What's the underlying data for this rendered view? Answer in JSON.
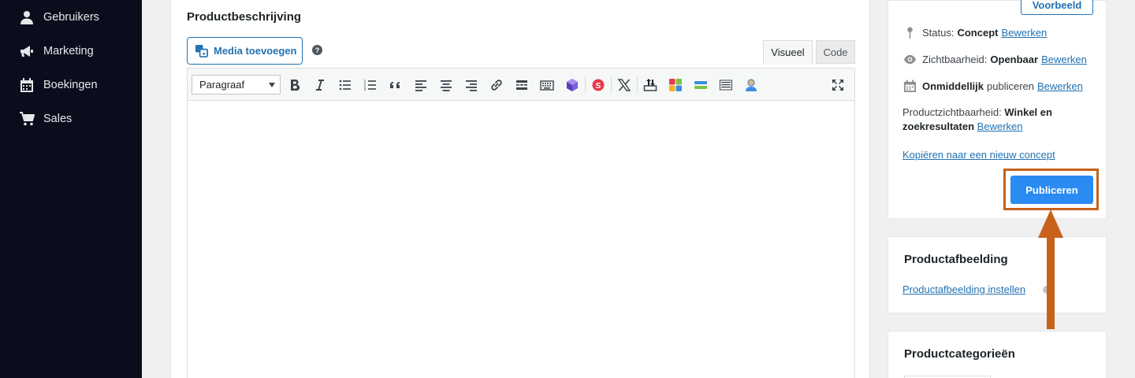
{
  "sidebar": {
    "items": [
      {
        "label": "Gebruikers",
        "icon": "user-icon"
      },
      {
        "label": "Marketing",
        "icon": "megaphone-icon"
      },
      {
        "label": "Boekingen",
        "icon": "calendar-icon"
      },
      {
        "label": "Sales",
        "icon": "cart-icon"
      }
    ]
  },
  "editor": {
    "title": "Productbeschrijving",
    "media_button": "Media toevoegen",
    "help": "?",
    "tabs": {
      "visual": "Visueel",
      "code": "Code"
    },
    "format_select": "Paragraaf",
    "toolbar_icons": [
      "bold-icon",
      "italic-icon",
      "bullet-list-icon",
      "numbered-list-icon",
      "blockquote-icon",
      "align-left-icon",
      "align-center-icon",
      "align-right-icon",
      "link-icon",
      "read-more-icon",
      "keyboard-icon",
      "plugin-hexagon-icon",
      "plugin-s-icon",
      "x-icon",
      "upload-icon",
      "grid-plugin-icon",
      "bars-plugin-icon",
      "lines-plugin-icon",
      "person-plugin-icon",
      "fullscreen-icon"
    ]
  },
  "publish": {
    "preview_button": "Voorbeeld",
    "status_label": "Status:",
    "status_value": "Concept",
    "visibility_label": "Zichtbaarheid:",
    "visibility_value": "Openbaar",
    "schedule_value": "Onmiddellijk",
    "schedule_label": "publiceren",
    "edit_link": "Bewerken",
    "catalog_label": "Productzichtbaarheid:",
    "catalog_value": "Winkel en zoekresultaten",
    "copy_link": "Kopiëren naar een nieuw concept",
    "publish_button": "Publiceren"
  },
  "product_image": {
    "title": "Productafbeelding",
    "set_link": "Productafbeelding instellen"
  },
  "categories": {
    "title": "Productcategorieën"
  },
  "colors": {
    "sidebar_bg": "#0c0d1c",
    "link": "#2271b1",
    "publish_bg": "#2a8bf2",
    "annotation": "#c7621a"
  }
}
